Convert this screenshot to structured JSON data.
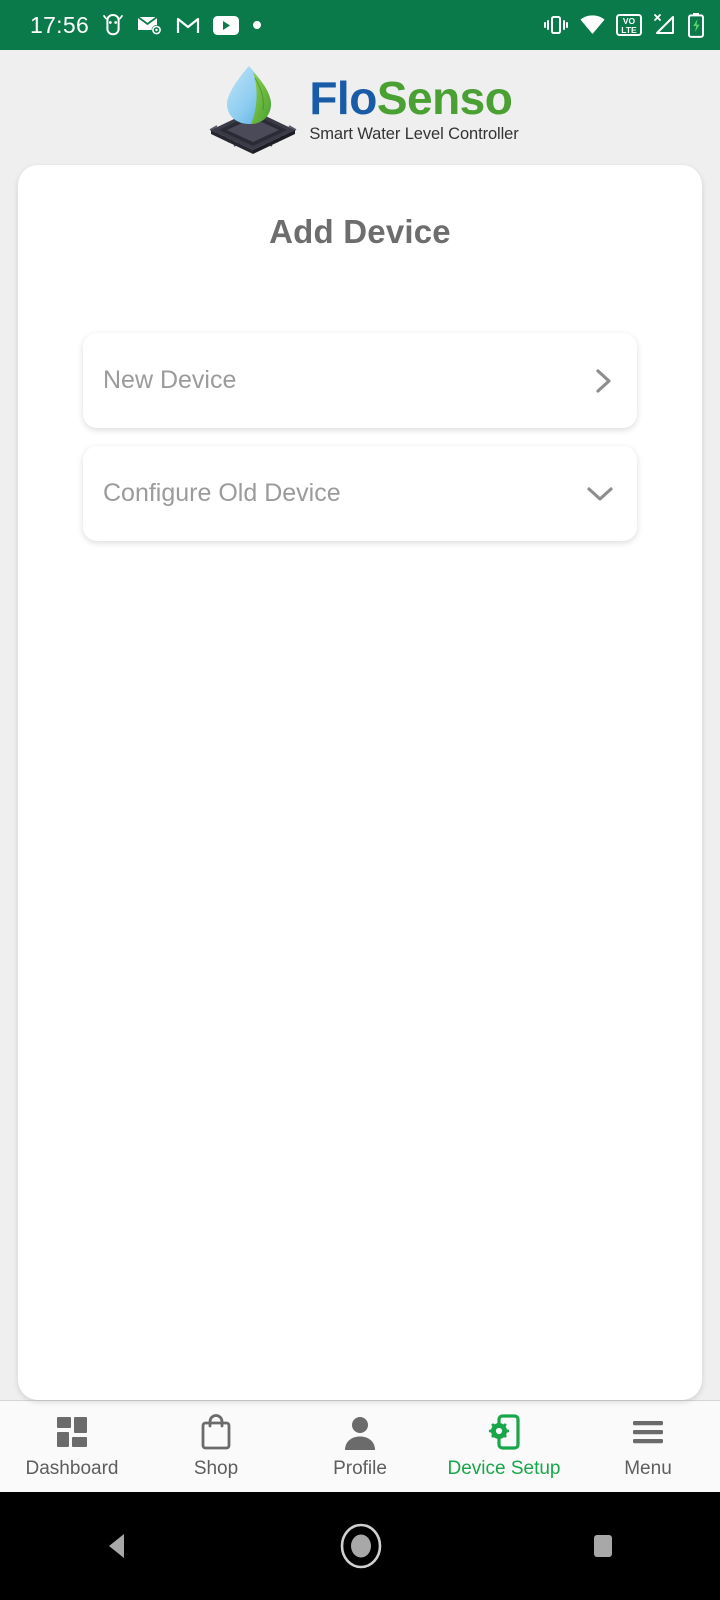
{
  "status_bar": {
    "time": "17:56",
    "background_color": "#0a7a4a",
    "left_icons": [
      "android-notification-icon",
      "mail-settings-icon",
      "gmail-icon",
      "youtube-icon",
      "dot-notification-icon"
    ],
    "right_icons": [
      "vibrate-icon",
      "wifi-icon",
      "volte-icon",
      "signal-no-service-icon",
      "battery-charging-icon"
    ],
    "volte_label_top": "VO",
    "volte_label_bottom": "LTE"
  },
  "brand": {
    "name_part1": "Flo",
    "name_part2": "Senso",
    "tagline": "Smart Water Level Controller",
    "color_part1": "#1a5ba8",
    "color_part2": "#4aa033",
    "logo_icon": "water-droplet-on-chip-logo"
  },
  "main": {
    "title": "Add Device",
    "options": [
      {
        "label": "New Device",
        "icon": "chevron-right-icon"
      },
      {
        "label": "Configure Old Device",
        "icon": "chevron-down-icon"
      }
    ]
  },
  "bottom_nav": {
    "active_color": "#19a64a",
    "inactive_color": "#5e5e5e",
    "items": [
      {
        "label": "Dashboard",
        "icon": "dashboard-grid-icon",
        "active": false
      },
      {
        "label": "Shop",
        "icon": "shopping-bag-icon",
        "active": false
      },
      {
        "label": "Profile",
        "icon": "person-icon",
        "active": false
      },
      {
        "label": "Device Setup",
        "icon": "phone-gear-icon",
        "active": true
      },
      {
        "label": "Menu",
        "icon": "hamburger-menu-icon",
        "active": false
      }
    ]
  },
  "system_nav": {
    "back": "back-triangle-icon",
    "home": "home-circle-icon",
    "recents": "recents-square-icon"
  }
}
